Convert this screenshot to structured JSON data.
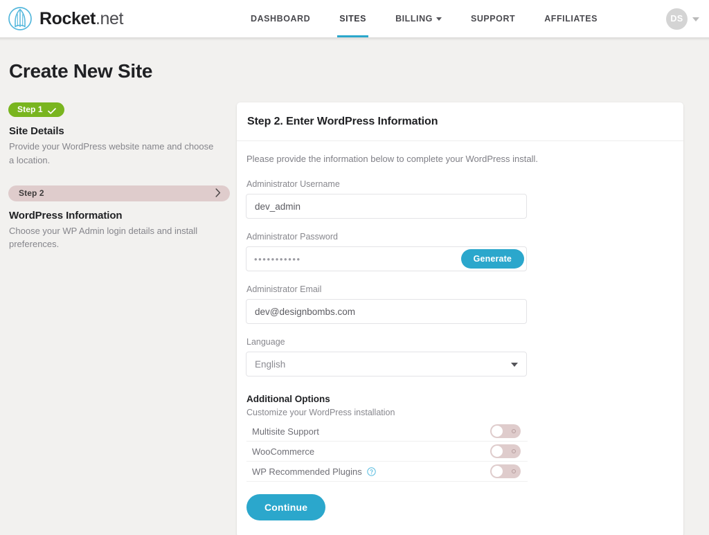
{
  "brand": {
    "name_bold": "Rocket",
    "name_light": ".net",
    "logo_icon": "rocket-circle-logo"
  },
  "nav": {
    "items": [
      {
        "label": "DASHBOARD",
        "active": false,
        "has_caret": false
      },
      {
        "label": "SITES",
        "active": true,
        "has_caret": false
      },
      {
        "label": "BILLING",
        "active": false,
        "has_caret": true
      },
      {
        "label": "SUPPORT",
        "active": false,
        "has_caret": false
      },
      {
        "label": "AFFILIATES",
        "active": false,
        "has_caret": false
      }
    ]
  },
  "account": {
    "initials": "DS",
    "caret_icon": "chevron-down-icon"
  },
  "page": {
    "title": "Create New Site"
  },
  "steps": [
    {
      "badge": "Step 1",
      "state": "complete",
      "badge_icon": "check-icon",
      "title": "Site Details",
      "description": "Provide your WordPress website name and choose a location."
    },
    {
      "badge": "Step 2",
      "state": "current",
      "badge_icon": "chevron-right-icon",
      "title": "WordPress Information",
      "description": "Choose your WP Admin login details and install preferences."
    }
  ],
  "card": {
    "title": "Step 2. Enter WordPress Information",
    "intro": "Please provide the information below to complete your WordPress install.",
    "fields": {
      "username": {
        "label": "Administrator Username",
        "value": "dev_admin",
        "placeholder": ""
      },
      "password": {
        "label": "Administrator Password",
        "masked_value": "•••••••••••",
        "button_label": "Generate"
      },
      "email": {
        "label": "Administrator Email",
        "value": "dev@designbombs.com",
        "placeholder": ""
      },
      "language": {
        "label": "Language",
        "value": "English",
        "arrow_icon": "caret-down-icon"
      }
    },
    "additional_options": {
      "title": "Additional Options",
      "subtitle": "Customize your WordPress installation",
      "options": [
        {
          "label": "Multisite Support",
          "enabled": false,
          "help_icon": null
        },
        {
          "label": "WooCommerce",
          "enabled": false,
          "help_icon": null
        },
        {
          "label": "WP Recommended Plugins",
          "enabled": false,
          "help_icon": "question-circle-icon"
        }
      ]
    },
    "continue_label": "Continue"
  },
  "colors": {
    "accent_blue": "#2ba7cc",
    "step_complete_green": "#79b51f",
    "step_current_mauve": "#dfcccc",
    "page_bg": "#f2f1ef",
    "card_bg": "#ffffff"
  }
}
